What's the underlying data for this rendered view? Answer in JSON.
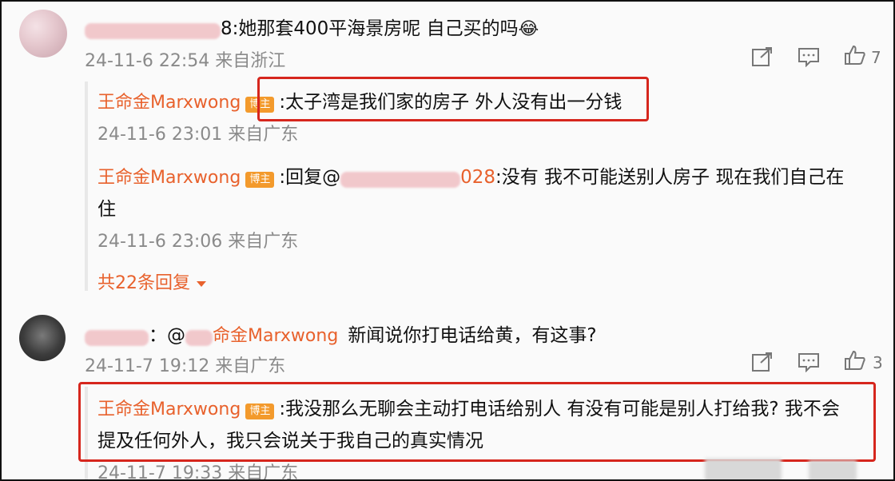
{
  "comment1": {
    "user_suffix": "8",
    "text": ":她那套400平海景房呢 自己买的吗",
    "emoji": "😂",
    "meta": "24-11-6 22:54 来自浙江",
    "likes": "7"
  },
  "reply1": {
    "author": "王命金Marxwong",
    "badge": "博主",
    "text": ":太子湾是我们家的房子 外人没有出一分钱",
    "meta": "24-11-6 23:01 来自广东"
  },
  "reply2": {
    "author": "王命金Marxwong",
    "badge": "博主",
    "prefix": ":回复@",
    "user_suffix": "028",
    "text_line1": ":没有 我不可能送别人房子  现在我们自己在",
    "text_line2": "住",
    "meta": "24-11-6 23:06 来自广东"
  },
  "more_replies": "共22条回复",
  "comment2": {
    "mention_prefix": "：@",
    "mention_visible": "命金Marxwong",
    "text": "新闻说你打电话给黄，有这事?",
    "meta": "24-11-7 19:12 来自广东",
    "likes": "3"
  },
  "reply3": {
    "author": "王命金Marxwong",
    "badge": "博主",
    "text_line1": ":我没那么无聊会主动打电话给别人 有没有可能是别人打给我? 我不会",
    "text_line2": "提及任何外人，我只会说关于我自己的真实情况",
    "meta": "24-11-7 19:33 来自广东"
  },
  "colors": {
    "accent": "#e8612c",
    "highlight": "#d6261d",
    "badge": "#f39a2c"
  }
}
